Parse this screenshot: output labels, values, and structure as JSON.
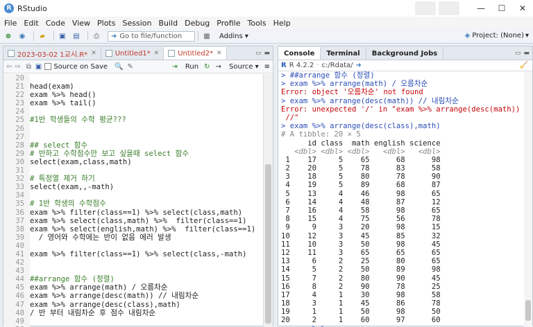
{
  "app": {
    "title": "RStudio"
  },
  "menu": [
    "File",
    "Edit",
    "Code",
    "View",
    "Plots",
    "Session",
    "Build",
    "Debug",
    "Profile",
    "Tools",
    "Help"
  ],
  "toolbar": {
    "goto_placeholder": "Go to file/function",
    "addins": "Addins",
    "project": "Project: (None)"
  },
  "editor": {
    "tabs": [
      {
        "label": "2023-03-02 1교시.R*",
        "active": false
      },
      {
        "label": "Untitled1*",
        "active": false
      },
      {
        "label": "Untitled2*",
        "active": true
      }
    ],
    "source_on_save": "Source on Save",
    "run": "Run",
    "source": "Source",
    "lines": [
      {
        "n": "20",
        "t": ""
      },
      {
        "n": "21",
        "t": "head(exam)"
      },
      {
        "n": "22",
        "t": "exam %>% head()"
      },
      {
        "n": "23",
        "t": "exam %>% tail()"
      },
      {
        "n": "24",
        "t": ""
      },
      {
        "n": "25",
        "t": "#1반 학생들의 수학 평균???",
        "c": "cm"
      },
      {
        "n": "26",
        "t": ""
      },
      {
        "n": "27",
        "t": ""
      },
      {
        "n": "28",
        "t": "## select 함수",
        "c": "cm"
      },
      {
        "n": "29",
        "t": "# 반하고 수학점수만 보고 싶을때 select 함수",
        "c": "cm"
      },
      {
        "n": "30",
        "t": "select(exam,class,math)"
      },
      {
        "n": "31",
        "t": ""
      },
      {
        "n": "32",
        "t": "# 특정열 제거 하기",
        "c": "cm"
      },
      {
        "n": "33",
        "t": "select(exam,,-math)"
      },
      {
        "n": "34",
        "t": ""
      },
      {
        "n": "35",
        "t": "# 1반 학생의 수학점수",
        "c": "cm"
      },
      {
        "n": "36",
        "t": "exam %>% filter(class==1) %>% select(class,math)"
      },
      {
        "n": "37",
        "t": "exam %>% select(class,math) %>%  filter(class==1)"
      },
      {
        "n": "38",
        "t": "exam %>% select(english,math) %>%  filter(class==1)"
      },
      {
        "n": "39",
        "t": "  / 영어와 수학에는 반이 없음 에러 발생"
      },
      {
        "n": "40",
        "t": ""
      },
      {
        "n": "41",
        "t": "exam %>% filter(class==1) %>% select(class,-math)"
      },
      {
        "n": "42",
        "t": ""
      },
      {
        "n": "43",
        "t": ""
      },
      {
        "n": "44",
        "t": "##arrange 함수 (정렬)",
        "c": "cm"
      },
      {
        "n": "45",
        "t": "exam %>% arrange(math) / 오름차순"
      },
      {
        "n": "46",
        "t": "exam %>% arrange(desc(math)) // 내림차순"
      },
      {
        "n": "47",
        "t": "exam %>% arrange(desc(class),math)"
      },
      {
        "n": "48",
        "t": "/ 반 부터 내림차순 후 점수 내림차순"
      },
      {
        "n": "49",
        "t": ""
      },
      {
        "n": "50",
        "t": ""
      }
    ]
  },
  "console": {
    "tabs": [
      "Console",
      "Terminal",
      "Background Jobs"
    ],
    "rversion": "R 4.2.2",
    "path": "c:/Rdata/",
    "lines": [
      {
        "t": "> ##arrange 함수 (정렬)",
        "c": "prompt"
      },
      {
        "t": "> exam %>% arrange(math) / 오름차순",
        "c": "prompt"
      },
      {
        "t": "Error: object '오름차순' not found",
        "c": "err"
      },
      {
        "t": "> exam %>% arrange(desc(math)) // 내림차순",
        "c": "prompt"
      },
      {
        "t": "Error: unexpected '/' in \"exam %>% arrange(desc(math))",
        "c": "err"
      },
      {
        "t": " //\"",
        "c": "err"
      },
      {
        "t": "> exam %>% arrange(desc(class),math)",
        "c": "prompt"
      },
      {
        "t": "# A tibble: 20 × 5",
        "c": "gray"
      },
      {
        "t": "      id class  math english science",
        "c": ""
      },
      {
        "t": "   <dbl> <dbl> <dbl>   <dbl>   <dbl>",
        "c": "hd"
      },
      {
        "t": " 1    17     5    65      68      98",
        "c": ""
      },
      {
        "t": " 2    20     5    78      83      58",
        "c": ""
      },
      {
        "t": " 3    18     5    80      78      90",
        "c": ""
      },
      {
        "t": " 4    19     5    89      68      87",
        "c": ""
      },
      {
        "t": " 5    13     4    46      98      65",
        "c": ""
      },
      {
        "t": " 6    14     4    48      87      12",
        "c": ""
      },
      {
        "t": " 7    16     4    58      98      65",
        "c": ""
      },
      {
        "t": " 8    15     4    75      56      78",
        "c": ""
      },
      {
        "t": " 9     9     3    20      98      15",
        "c": ""
      },
      {
        "t": "10    12     3    45      85      32",
        "c": ""
      },
      {
        "t": "11    10     3    50      98      45",
        "c": ""
      },
      {
        "t": "12    11     3    65      65      65",
        "c": ""
      },
      {
        "t": "13     6     2    25      80      65",
        "c": ""
      },
      {
        "t": "14     5     2    50      89      98",
        "c": ""
      },
      {
        "t": "15     7     2    80      90      45",
        "c": ""
      },
      {
        "t": "16     8     2    90      78      25",
        "c": ""
      },
      {
        "t": "17     4     1    30      98      58",
        "c": ""
      },
      {
        "t": "18     3     1    45      86      78",
        "c": ""
      },
      {
        "t": "19     1     1    50      98      50",
        "c": ""
      },
      {
        "t": "20     2     1    60      97      60",
        "c": ""
      },
      {
        "t": "> exam %>%",
        "c": "prompt"
      }
    ]
  }
}
